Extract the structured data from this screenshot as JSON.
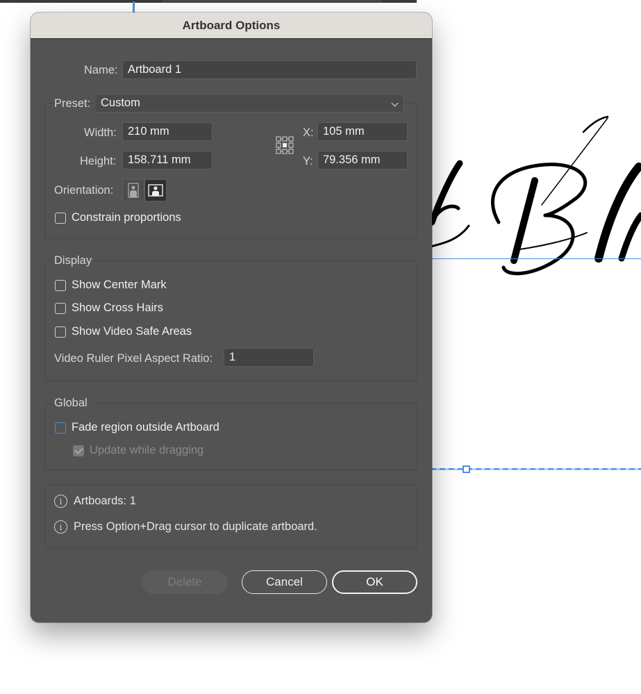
{
  "dialog": {
    "title": "Artboard Options",
    "name": {
      "label": "Name:",
      "value": "Artboard 1"
    },
    "preset": {
      "label": "Preset:",
      "value": "Custom"
    },
    "width": {
      "label": "Width:",
      "value": "210 mm"
    },
    "height": {
      "label": "Height:",
      "value": "158.711 mm"
    },
    "x": {
      "label": "X:",
      "value": "105 mm"
    },
    "y": {
      "label": "Y:",
      "value": "79.356 mm"
    },
    "orientation": {
      "label": "Orientation:",
      "selected": "landscape"
    },
    "constrain": {
      "label": "Constrain proportions",
      "checked": false
    },
    "display": {
      "title": "Display",
      "center_mark": {
        "label": "Show Center Mark",
        "checked": false
      },
      "cross_hairs": {
        "label": "Show Cross Hairs",
        "checked": false
      },
      "video_safe": {
        "label": "Show Video Safe Areas",
        "checked": false
      },
      "aspect_ratio": {
        "label": "Video Ruler Pixel Aspect Ratio:",
        "value": "1"
      }
    },
    "global": {
      "title": "Global",
      "fade": {
        "label": "Fade region outside Artboard",
        "checked": false
      },
      "update": {
        "label": "Update while dragging",
        "checked": true,
        "disabled": true
      }
    },
    "info": {
      "artboards": "Artboards: 1",
      "hint": "Press Option+Drag cursor to duplicate artboard."
    },
    "buttons": {
      "delete": "Delete",
      "cancel": "Cancel",
      "ok": "OK"
    }
  },
  "colors": {
    "accent": "#4a8fe7",
    "dialog_bg": "#535353",
    "titlebar_bg": "#e1ddd9"
  }
}
